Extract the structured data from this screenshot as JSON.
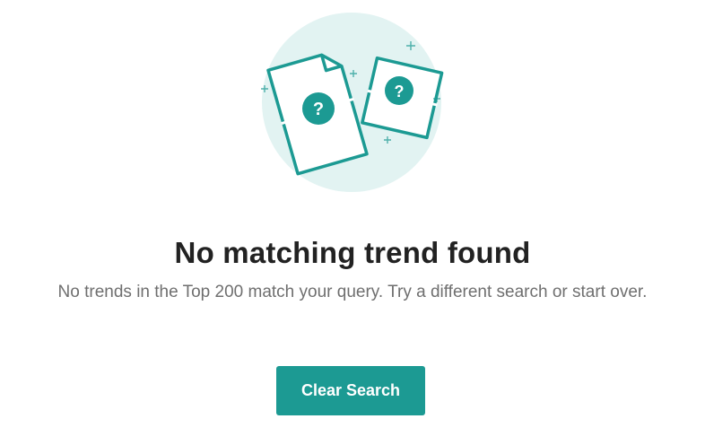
{
  "empty_state": {
    "icon": "document-question-icon",
    "title": "No matching trend found",
    "message": "No trends in the Top 200 match your query. Try a different search or start over.",
    "clear_button_label": "Clear Search"
  },
  "colors": {
    "accent": "#1c9a93",
    "circle": "#e2f3f2",
    "title": "#222222",
    "message": "#6f6f6f"
  }
}
